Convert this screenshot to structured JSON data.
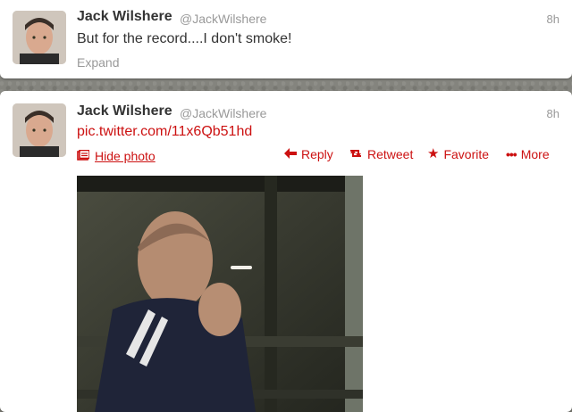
{
  "tweets": [
    {
      "name": "Jack Wilshere",
      "handle": "@JackWilshere",
      "time": "8h",
      "text": "But for the record....I don't smoke!",
      "expand_label": "Expand"
    },
    {
      "name": "Jack Wilshere",
      "handle": "@JackWilshere",
      "time": "8h",
      "link": "pic.twitter.com/11x6Qb51hd",
      "hide_photo_label": "Hide photo",
      "actions": {
        "reply": "Reply",
        "retweet": "Retweet",
        "favorite": "Favorite",
        "more": "More"
      }
    }
  ],
  "icons": {
    "reply": "reply-arrow-icon",
    "retweet": "retweet-icon",
    "favorite": "star-icon",
    "more": "ellipsis-icon",
    "photo": "photo-icon"
  },
  "colors": {
    "accent": "#cc1111",
    "text": "#333333",
    "muted": "#999999"
  }
}
